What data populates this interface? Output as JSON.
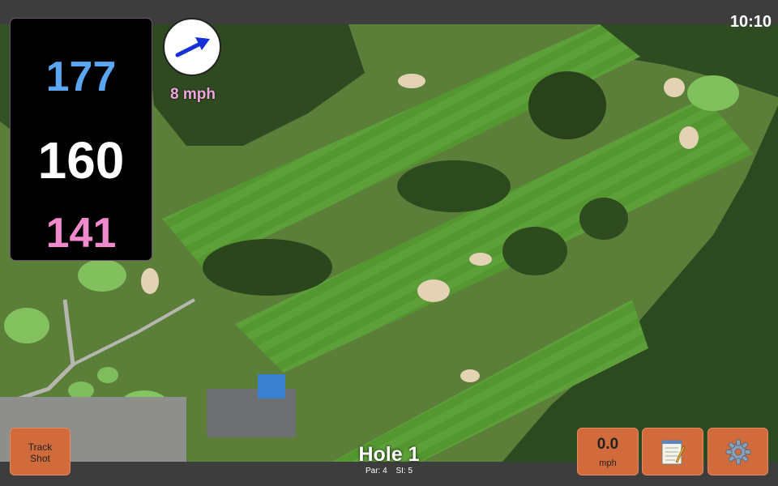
{
  "status_bar": {
    "time": "10:10"
  },
  "distances": {
    "back": "177",
    "middle": "160",
    "front": "141",
    "back_color": "#5aa6f0",
    "middle_color": "#ffffff",
    "front_color": "#f08acd"
  },
  "wind": {
    "speed_label": "8 mph",
    "direction_icon": "arrow-icon"
  },
  "buttons": {
    "track_shot_line1": "Track",
    "track_shot_line2": "Shot",
    "speed_value": "0.0",
    "speed_unit": "mph",
    "notes_icon": "notepad-icon",
    "settings_icon": "gear-icon",
    "accent": "#d26b3c"
  },
  "hole": {
    "title": "Hole 1",
    "par": "Par: 4",
    "si": "SI: 5"
  }
}
